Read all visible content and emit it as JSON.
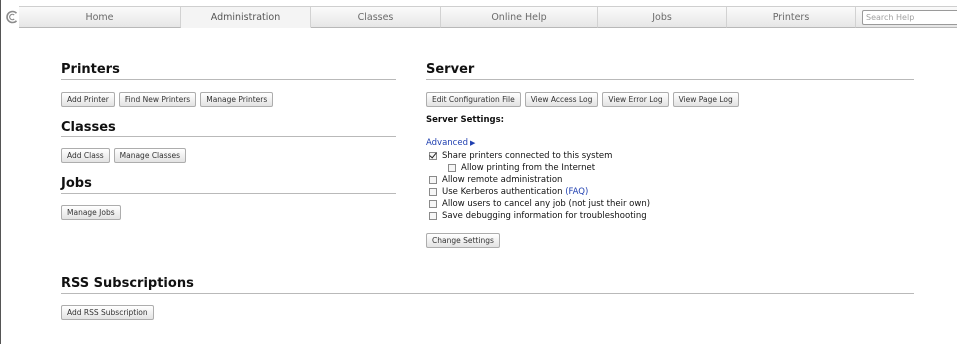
{
  "nav": {
    "tabs": [
      {
        "label": "Home"
      },
      {
        "label": "Administration"
      },
      {
        "label": "Classes"
      },
      {
        "label": "Online Help"
      },
      {
        "label": "Jobs"
      },
      {
        "label": "Printers"
      }
    ],
    "active_tab": "Administration",
    "search_placeholder": "Search Help",
    "logo_icon": "cups-logo-icon"
  },
  "printers": {
    "title": "Printers",
    "buttons": [
      "Add Printer",
      "Find New Printers",
      "Manage Printers"
    ]
  },
  "classes": {
    "title": "Classes",
    "buttons": [
      "Add Class",
      "Manage Classes"
    ]
  },
  "jobs": {
    "title": "Jobs",
    "buttons": [
      "Manage Jobs"
    ]
  },
  "server": {
    "title": "Server",
    "buttons": [
      "Edit Configuration File",
      "View Access Log",
      "View Error Log",
      "View Page Log"
    ],
    "settings_title": "Server Settings:",
    "advanced_label": "Advanced",
    "options": {
      "share_printers": {
        "label": "Share printers connected to this system",
        "checked": true
      },
      "allow_internet": {
        "label": "Allow printing from the Internet",
        "checked": false
      },
      "remote_admin": {
        "label": "Allow remote administration",
        "checked": false
      },
      "kerberos": {
        "label": "Use Kerberos authentication",
        "link": "(FAQ)",
        "checked": false
      },
      "cancel_any_job": {
        "label": "Allow users to cancel any job (not just their own)",
        "checked": false
      },
      "debug_info": {
        "label": "Save debugging information for troubleshooting",
        "checked": false
      }
    },
    "change_settings_label": "Change Settings"
  },
  "rss": {
    "title": "RSS Subscriptions",
    "buttons": [
      "Add RSS Subscription"
    ]
  },
  "colors": {
    "link": "#1f3fb0",
    "rule": "#b9b9b9",
    "tab_text": "#6a6a6a"
  }
}
